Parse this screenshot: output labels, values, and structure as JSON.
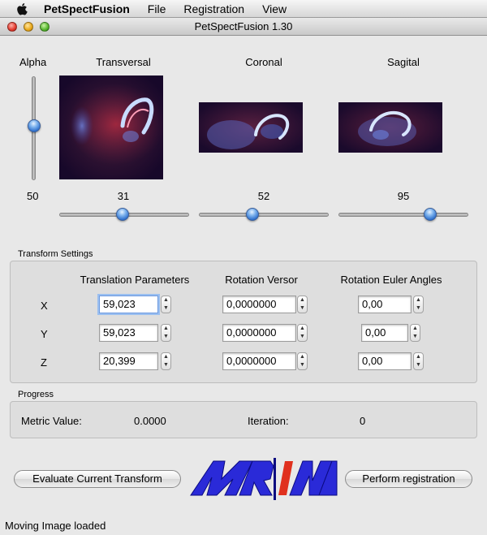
{
  "menubar": {
    "app_name": "PetSpectFusion",
    "items": [
      "File",
      "Registration",
      "View"
    ]
  },
  "window": {
    "title": "PetSpectFusion 1.30"
  },
  "views": {
    "alpha_label": "Alpha",
    "alpha_value": "50",
    "alpha_fraction": 0.5,
    "transversal": {
      "label": "Transversal",
      "value": "31",
      "fraction": 0.49
    },
    "coronal": {
      "label": "Coronal",
      "value": "52",
      "fraction": 0.49
    },
    "sagital": {
      "label": "Sagital",
      "value": "95",
      "fraction": 0.71
    }
  },
  "transform": {
    "group_title": "Transform Settings",
    "col_translation": "Translation Parameters",
    "col_rotation_versor": "Rotation Versor",
    "col_euler": "Rotation Euler Angles",
    "rows": [
      {
        "axis": "X",
        "translation": "59,023",
        "versor": "0,0000000",
        "euler": "0,00"
      },
      {
        "axis": "Y",
        "translation": "59,023",
        "versor": "0,0000000",
        "euler": "0,00"
      },
      {
        "axis": "Z",
        "translation": "20,399",
        "versor": "0,0000000",
        "euler": "0,00"
      }
    ]
  },
  "progress": {
    "group_title": "Progress",
    "metric_label": "Metric Value:",
    "metric_value": "0.0000",
    "iteration_label": "Iteration:",
    "iteration_value": "0"
  },
  "actions": {
    "evaluate_label": "Evaluate Current Transform",
    "perform_label": "Perform registration",
    "logo_text": "MRINM"
  },
  "status": "Moving Image loaded",
  "colors": {
    "slider_knob": "#2e6fcc",
    "logo_blue": "#2a2ad8",
    "logo_red": "#e0301e"
  }
}
